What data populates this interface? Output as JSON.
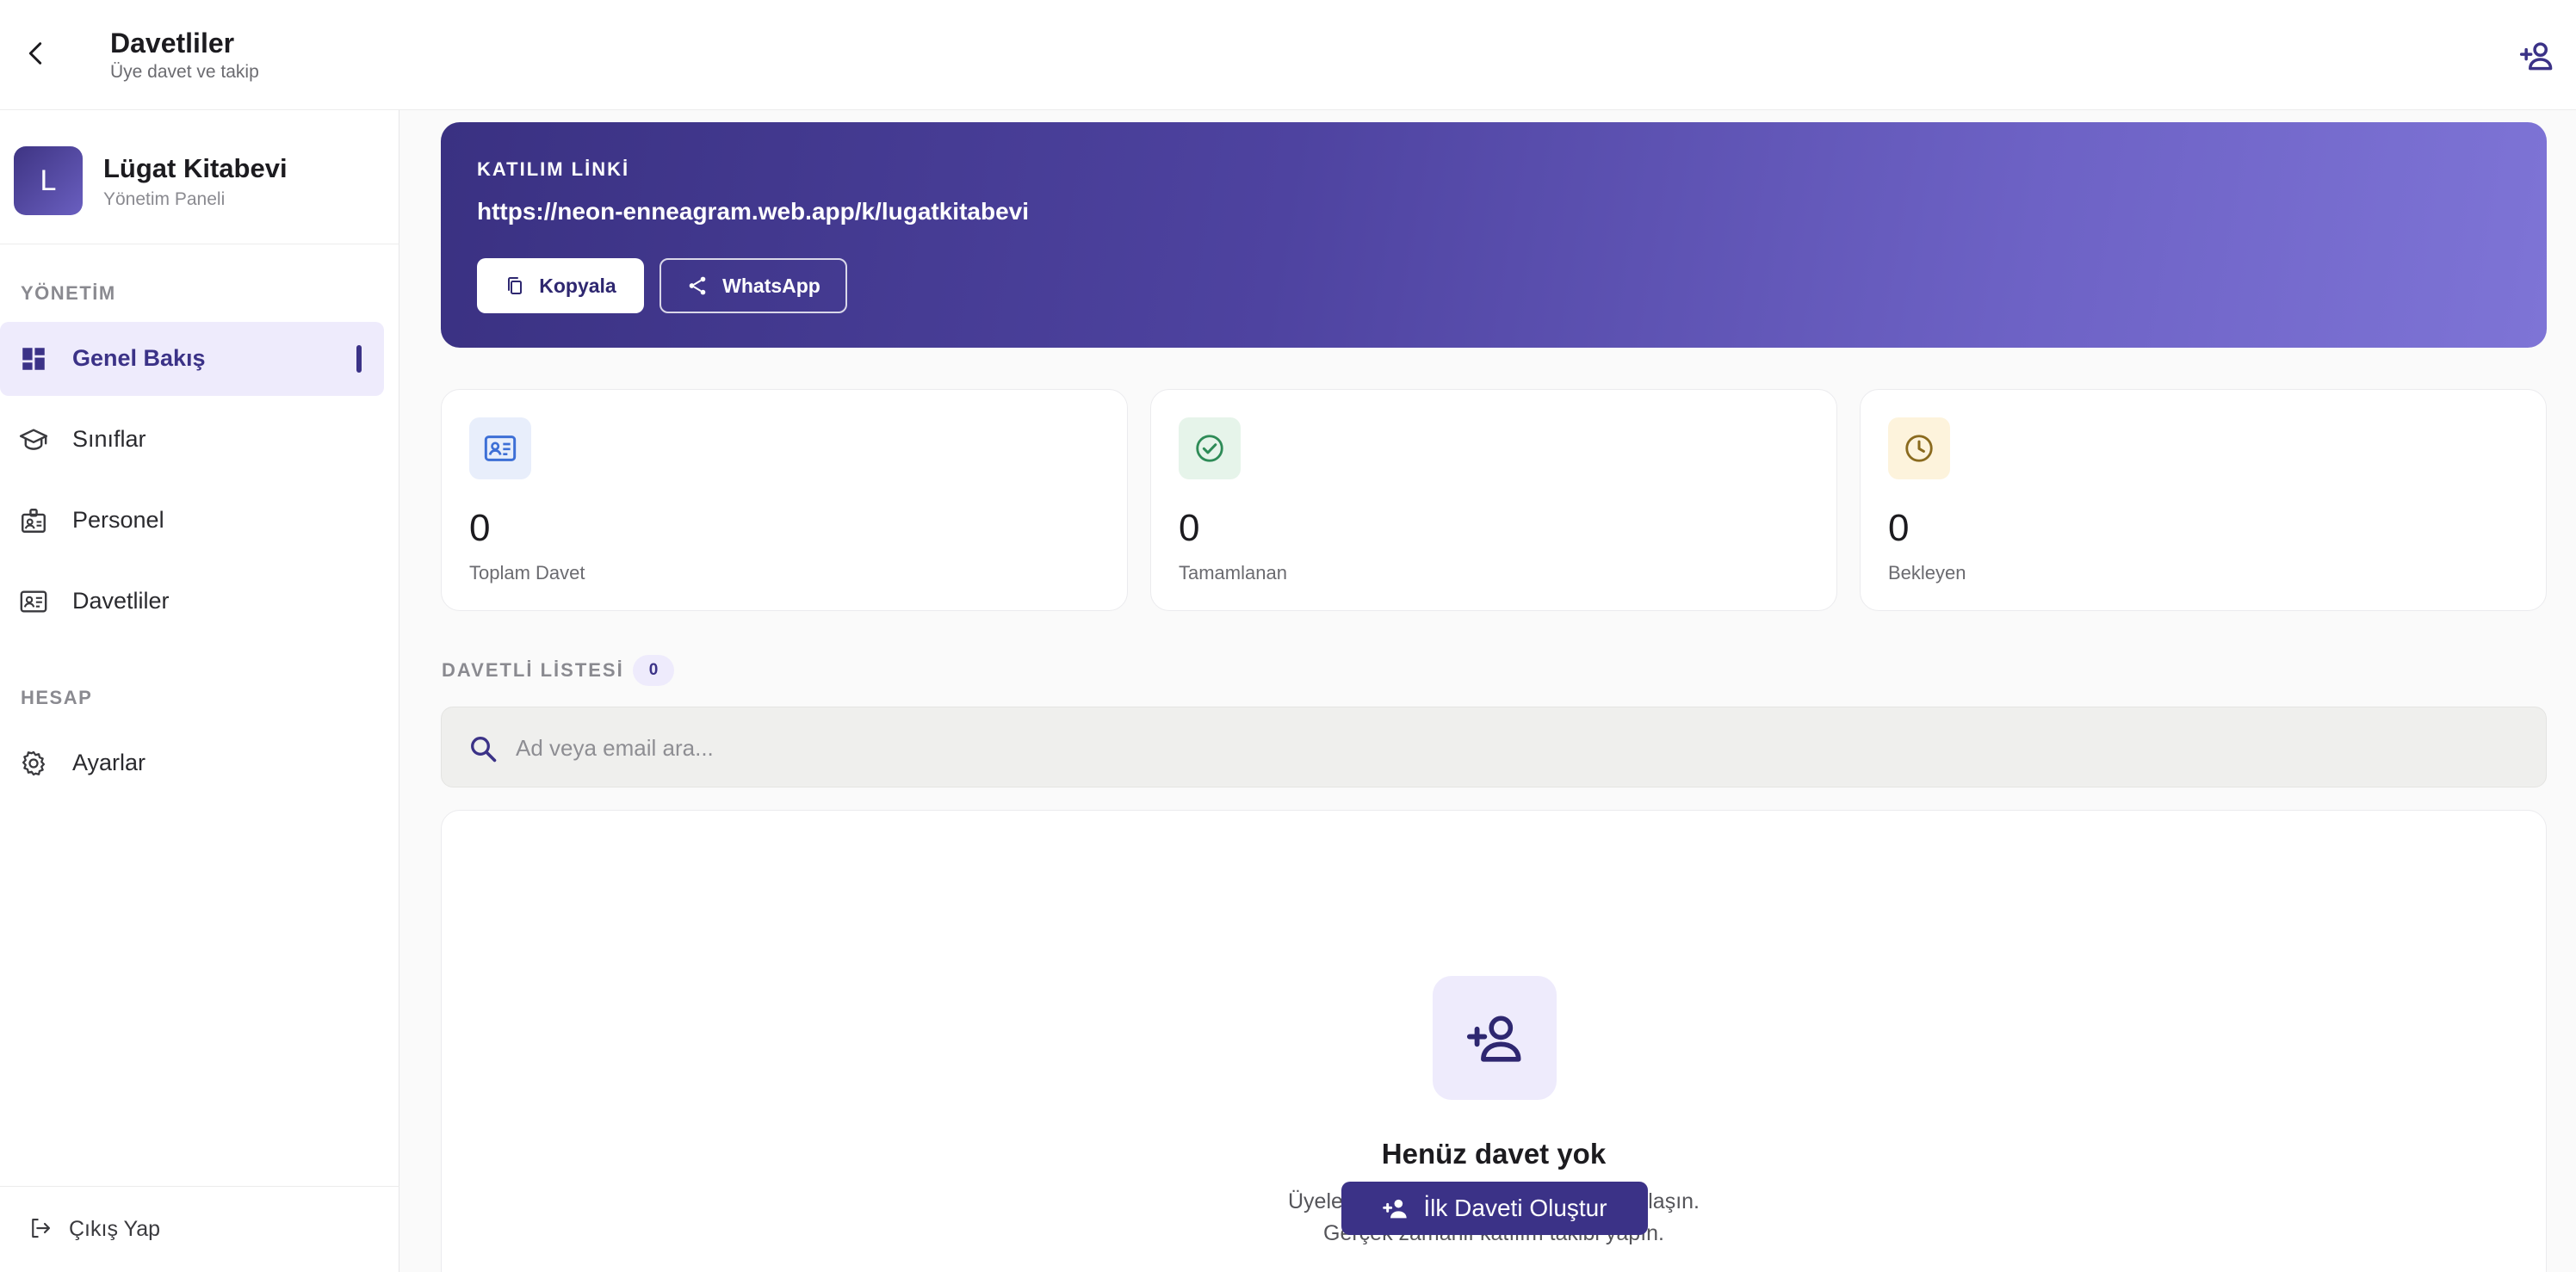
{
  "header": {
    "title": "Davetliler",
    "subtitle": "Üye davet ve takip",
    "back_icon": "arrow-back-icon",
    "action_icon": "person-add-icon"
  },
  "sidebar": {
    "org": {
      "initial": "L",
      "name": "Lügat Kitabevi",
      "role": "Yönetim Paneli"
    },
    "sections": [
      {
        "label": "YÖNETİM",
        "items": [
          {
            "label": "Genel Bakış",
            "icon": "dashboard-icon",
            "active": true
          },
          {
            "label": "Sınıflar",
            "icon": "school-icon",
            "active": false
          },
          {
            "label": "Personel",
            "icon": "badge-icon",
            "active": false
          },
          {
            "label": "Davetliler",
            "icon": "contact-card-icon",
            "active": false
          }
        ]
      },
      {
        "label": "HESAP",
        "items": [
          {
            "label": "Ayarlar",
            "icon": "gear-icon",
            "active": false
          }
        ]
      }
    ],
    "logout_label": "Çıkış Yap"
  },
  "banner": {
    "label": "KATILIM LİNKİ",
    "link": "https://neon-enneagram.web.app/k/lugatkitabevi",
    "copy_label": "Kopyala",
    "whatsapp_label": "WhatsApp"
  },
  "stats": [
    {
      "value": "0",
      "label": "Toplam Davet",
      "icon": "contact-card-icon",
      "color": "#3d6fd6"
    },
    {
      "value": "0",
      "label": "Tamamlanan",
      "icon": "check-circle-icon",
      "color": "#2e8b57"
    },
    {
      "value": "0",
      "label": "Bekleyen",
      "icon": "clock-icon",
      "color": "#8a6a1e"
    }
  ],
  "list": {
    "label": "DAVETLİ LİSTESİ",
    "count": "0"
  },
  "search": {
    "placeholder": "Ad veya email ara..."
  },
  "empty": {
    "title": "Henüz davet yok",
    "line1": "Üyelerinizi ekleyin ve davet linkini paylaşın.",
    "line2": "Gerçek zamanlı katılım takibi yapın.",
    "button_label": "İlk Daveti Oluştur"
  },
  "colors": {
    "primary": "#3b3287",
    "active_bg": "#eeebfc"
  }
}
